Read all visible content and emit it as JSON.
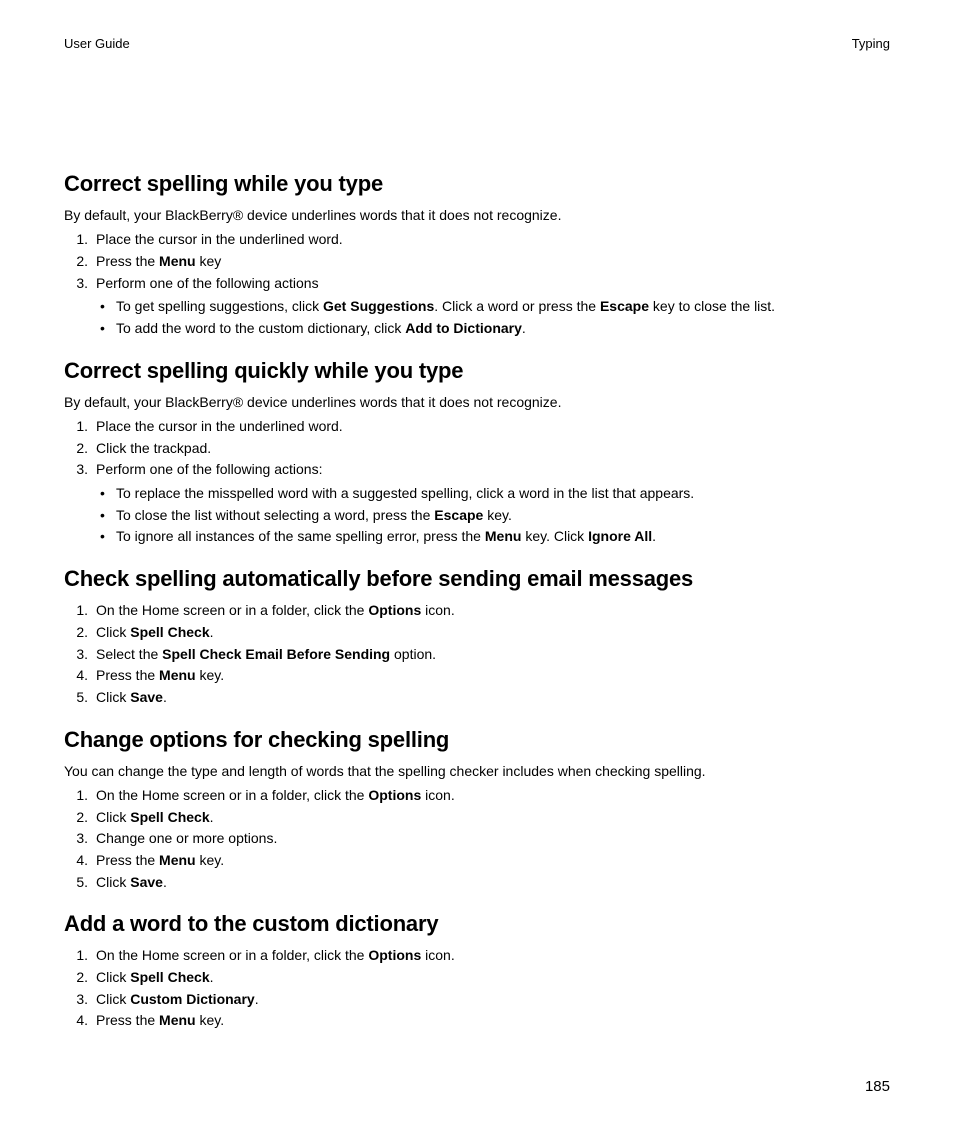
{
  "header": {
    "left": "User Guide",
    "right": "Typing"
  },
  "pagenum": "185",
  "sections": [
    {
      "title": "Correct spelling while you type",
      "intro": "By default, your BlackBerry® device underlines words that it does not recognize.",
      "steps": [
        {
          "parts": [
            {
              "t": "Place the cursor in the underlined word."
            }
          ]
        },
        {
          "parts": [
            {
              "t": "Press the "
            },
            {
              "t": "Menu",
              "b": true
            },
            {
              "t": " key"
            }
          ]
        },
        {
          "parts": [
            {
              "t": "Perform one of the following actions"
            }
          ],
          "sub": [
            {
              "parts": [
                {
                  "t": "To get spelling suggestions, click "
                },
                {
                  "t": "Get Suggestions",
                  "b": true
                },
                {
                  "t": ". Click a word or press the "
                },
                {
                  "t": "Escape",
                  "b": true
                },
                {
                  "t": " key to close the list."
                }
              ]
            },
            {
              "parts": [
                {
                  "t": "To add the word to the custom dictionary, click "
                },
                {
                  "t": "Add to Dictionary",
                  "b": true
                },
                {
                  "t": "."
                }
              ]
            }
          ]
        }
      ]
    },
    {
      "title": "Correct spelling quickly while you type",
      "intro": "By default, your BlackBerry® device underlines words that it does not recognize.",
      "steps": [
        {
          "parts": [
            {
              "t": "Place the cursor in the underlined word."
            }
          ]
        },
        {
          "parts": [
            {
              "t": "Click the trackpad."
            }
          ]
        },
        {
          "parts": [
            {
              "t": "Perform one of the following actions:"
            }
          ],
          "sub": [
            {
              "parts": [
                {
                  "t": "To replace the misspelled word with a suggested spelling, click a word in the list that appears."
                }
              ]
            },
            {
              "parts": [
                {
                  "t": "To close the list without selecting a word, press the "
                },
                {
                  "t": "Escape",
                  "b": true
                },
                {
                  "t": " key."
                }
              ]
            },
            {
              "parts": [
                {
                  "t": "To ignore all instances of the same spelling error, press the "
                },
                {
                  "t": "Menu",
                  "b": true
                },
                {
                  "t": " key. Click "
                },
                {
                  "t": "Ignore All",
                  "b": true
                },
                {
                  "t": "."
                }
              ]
            }
          ]
        }
      ]
    },
    {
      "title": "Check spelling automatically before sending email messages",
      "steps": [
        {
          "parts": [
            {
              "t": "On the Home screen or in a folder, click the "
            },
            {
              "t": "Options",
              "b": true
            },
            {
              "t": " icon."
            }
          ]
        },
        {
          "parts": [
            {
              "t": "Click "
            },
            {
              "t": "Spell Check",
              "b": true
            },
            {
              "t": "."
            }
          ]
        },
        {
          "parts": [
            {
              "t": "Select the "
            },
            {
              "t": "Spell Check Email Before Sending",
              "b": true
            },
            {
              "t": " option."
            }
          ]
        },
        {
          "parts": [
            {
              "t": "Press the "
            },
            {
              "t": "Menu",
              "b": true
            },
            {
              "t": " key."
            }
          ]
        },
        {
          "parts": [
            {
              "t": "Click "
            },
            {
              "t": "Save",
              "b": true
            },
            {
              "t": "."
            }
          ]
        }
      ]
    },
    {
      "title": "Change options for checking spelling",
      "intro": "You can change the type and length of words that the spelling checker includes when checking spelling.",
      "steps": [
        {
          "parts": [
            {
              "t": "On the Home screen or in a folder, click the "
            },
            {
              "t": "Options",
              "b": true
            },
            {
              "t": " icon."
            }
          ]
        },
        {
          "parts": [
            {
              "t": "Click "
            },
            {
              "t": "Spell Check",
              "b": true
            },
            {
              "t": "."
            }
          ]
        },
        {
          "parts": [
            {
              "t": "Change one or more options."
            }
          ]
        },
        {
          "parts": [
            {
              "t": "Press the "
            },
            {
              "t": "Menu",
              "b": true
            },
            {
              "t": " key."
            }
          ]
        },
        {
          "parts": [
            {
              "t": "Click "
            },
            {
              "t": "Save",
              "b": true
            },
            {
              "t": "."
            }
          ]
        }
      ]
    },
    {
      "title": "Add a word to the custom dictionary",
      "steps": [
        {
          "parts": [
            {
              "t": "On the Home screen or in a folder, click the "
            },
            {
              "t": "Options",
              "b": true
            },
            {
              "t": " icon."
            }
          ]
        },
        {
          "parts": [
            {
              "t": "Click "
            },
            {
              "t": "Spell Check",
              "b": true
            },
            {
              "t": "."
            }
          ]
        },
        {
          "parts": [
            {
              "t": "Click "
            },
            {
              "t": "Custom Dictionary",
              "b": true
            },
            {
              "t": "."
            }
          ]
        },
        {
          "parts": [
            {
              "t": "Press the "
            },
            {
              "t": "Menu",
              "b": true
            },
            {
              "t": " key."
            }
          ]
        }
      ]
    }
  ]
}
